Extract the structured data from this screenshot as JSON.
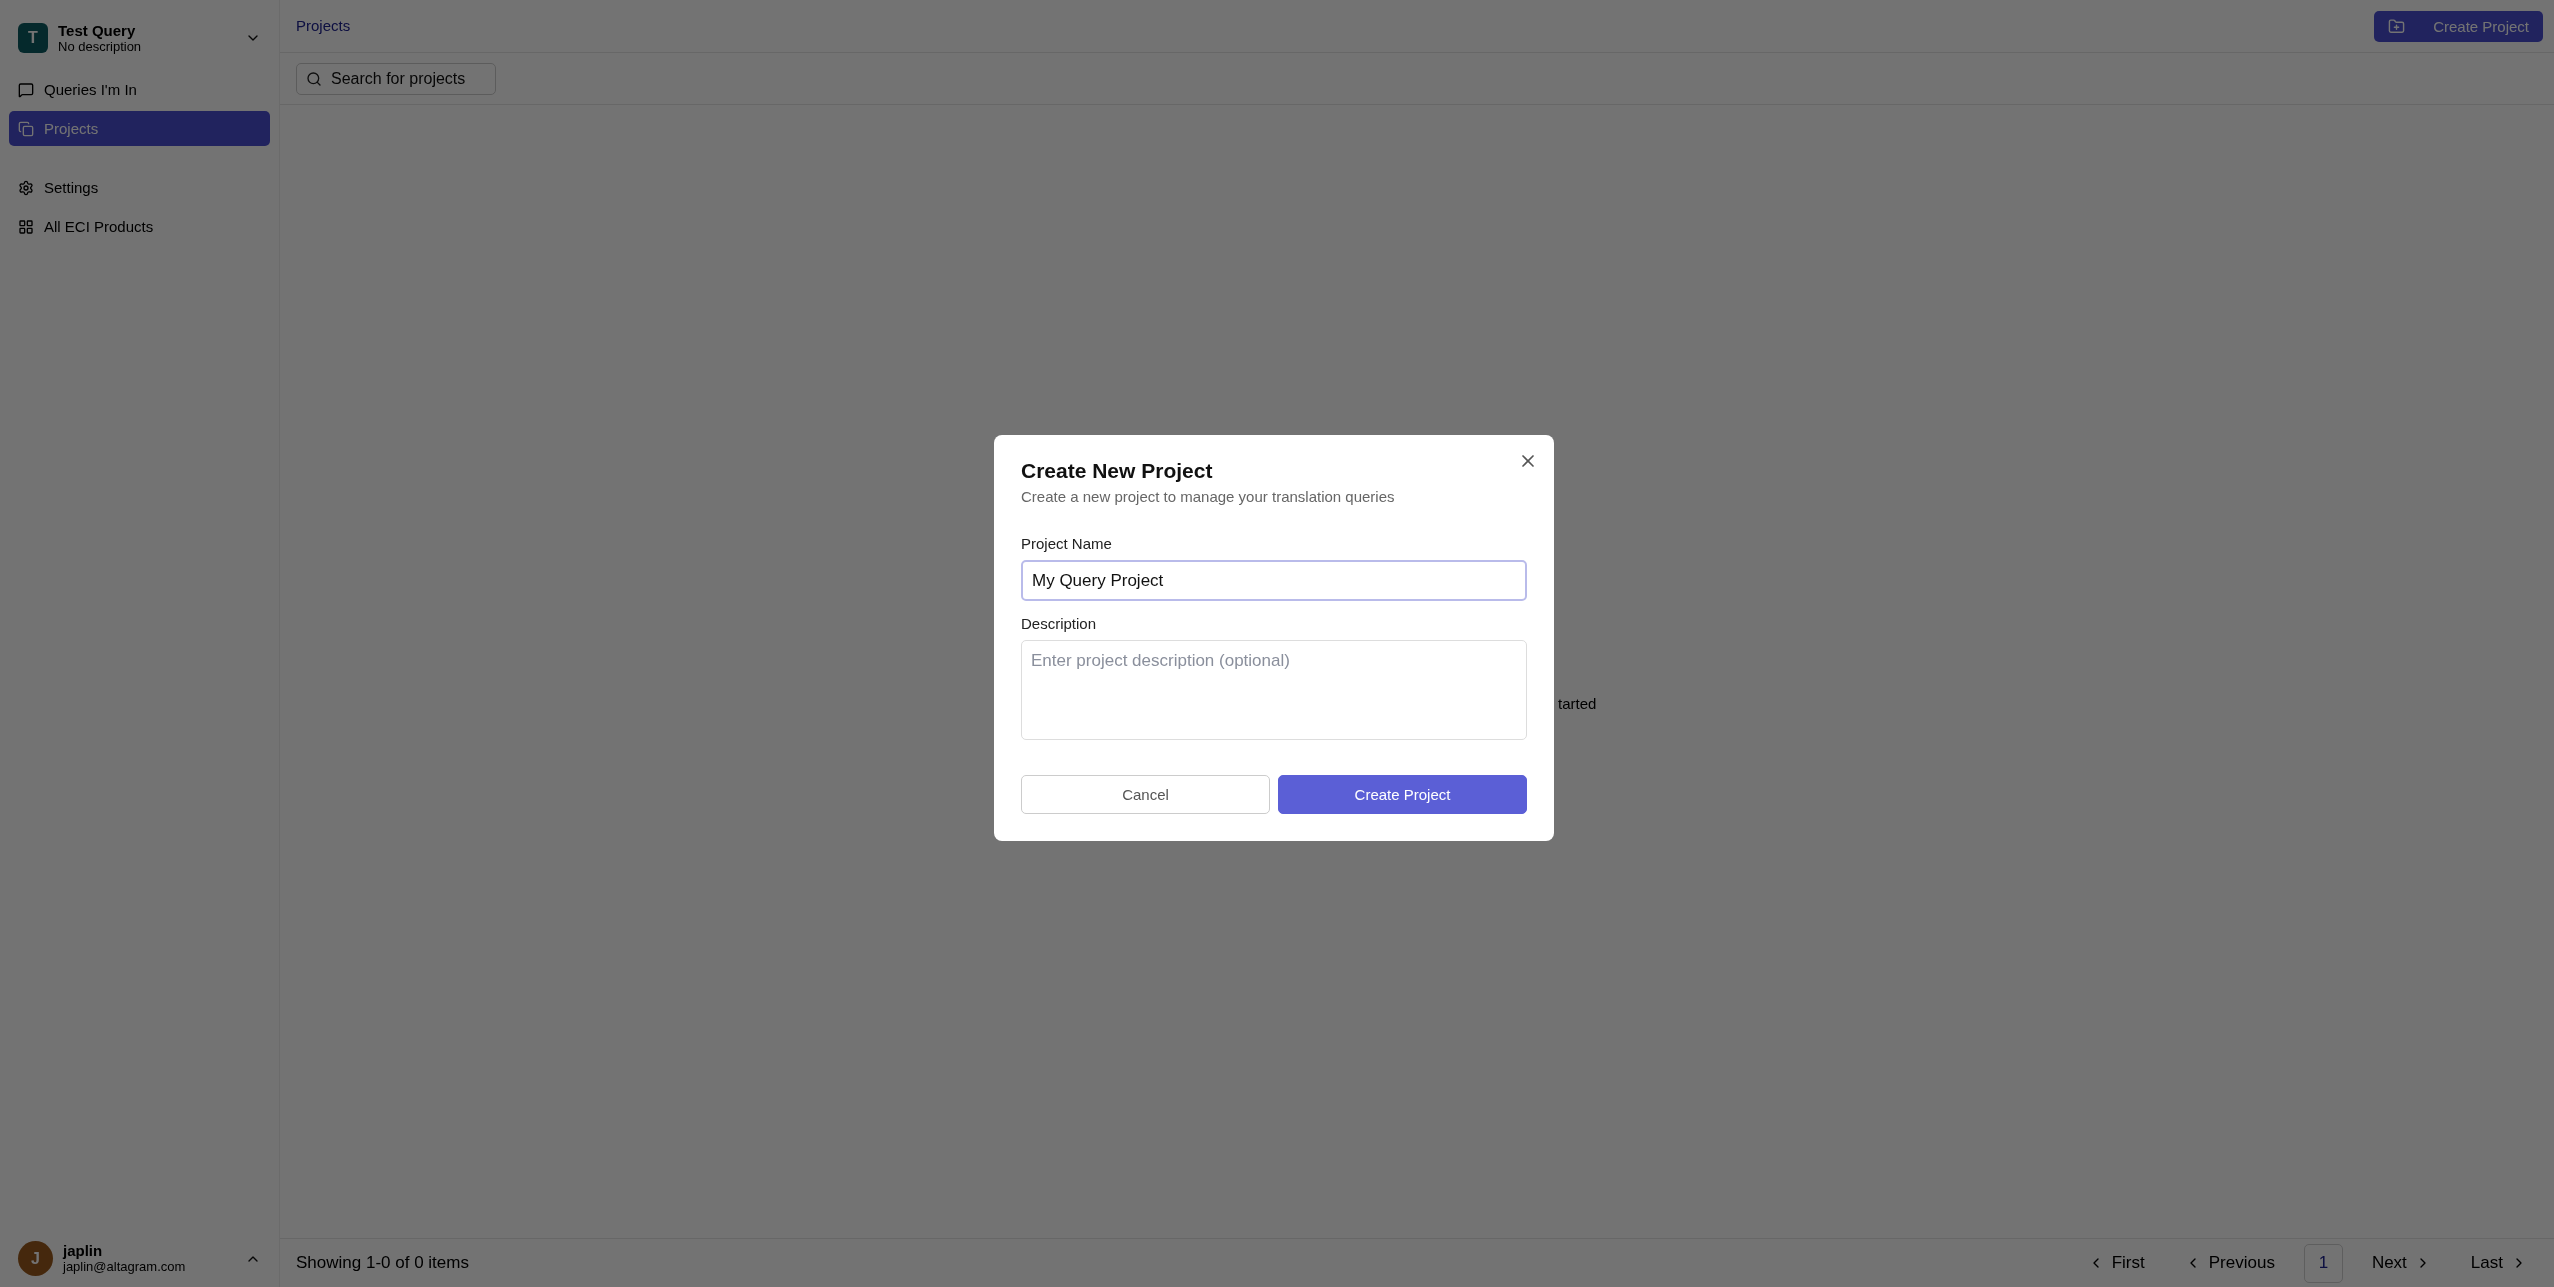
{
  "sidebar": {
    "workspace": {
      "initial": "T",
      "name": "Test Query",
      "description": "No description"
    },
    "nav": [
      {
        "label": "Queries I'm In",
        "selected": false
      },
      {
        "label": "Projects",
        "selected": true
      }
    ],
    "nav_secondary": [
      {
        "label": "Settings",
        "selected": false
      },
      {
        "label": "All ECI Products",
        "selected": false
      }
    ],
    "user": {
      "initial": "J",
      "name": "japlin",
      "email": "japlin@altagram.com"
    }
  },
  "header": {
    "breadcrumb": "Projects",
    "create_button": "Create Project"
  },
  "search": {
    "placeholder": "Search for projects"
  },
  "empty_state": {
    "text": "tarted"
  },
  "footer": {
    "summary": "Showing 1-0 of 0 items",
    "pagination": [
      {
        "label": "First",
        "kind": "prev",
        "selected": false
      },
      {
        "label": "Previous",
        "kind": "prev",
        "selected": false
      },
      {
        "label": "1",
        "kind": "page",
        "selected": true
      },
      {
        "label": "Next",
        "kind": "next",
        "selected": false
      },
      {
        "label": "Last",
        "kind": "next",
        "selected": false
      }
    ]
  },
  "modal": {
    "title": "Create New Project",
    "subtitle": "Create a new project to manage your translation queries",
    "name_label": "Project Name",
    "name_value": "My Query Project",
    "description_label": "Description",
    "description_placeholder": "Enter project description (optional)",
    "cancel": "Cancel",
    "submit": "Create Project"
  }
}
